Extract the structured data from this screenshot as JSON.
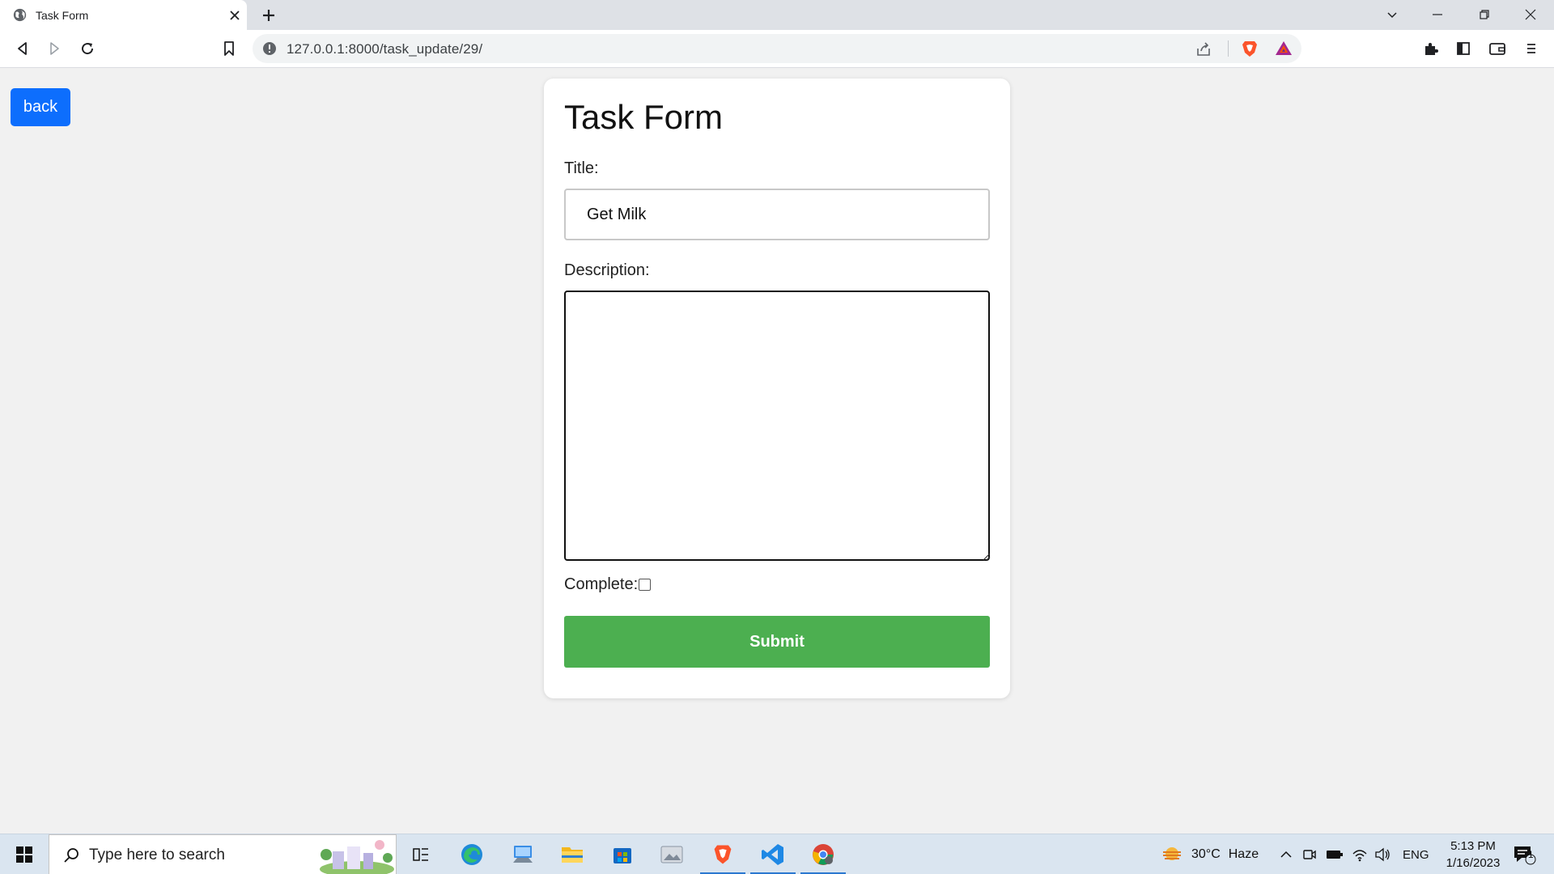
{
  "browser": {
    "tab_title": "Task Form",
    "url": "127.0.0.1:8000/task_update/29/"
  },
  "page": {
    "back_label": "back",
    "form_title": "Task Form",
    "title_label": "Title:",
    "title_value": "Get Milk",
    "description_label": "Description:",
    "description_value": "",
    "complete_label": "Complete:",
    "complete_checked": false,
    "submit_label": "Submit"
  },
  "taskbar": {
    "search_placeholder": "Type here to search",
    "weather_temp": "30°C",
    "weather_text": "Haze",
    "language": "ENG",
    "time": "5:13 PM",
    "date": "1/16/2023",
    "notification_count": "1"
  },
  "colors": {
    "back_button": "#0d6efd",
    "submit_button": "#4caf50",
    "page_background": "#f1f1f1"
  }
}
